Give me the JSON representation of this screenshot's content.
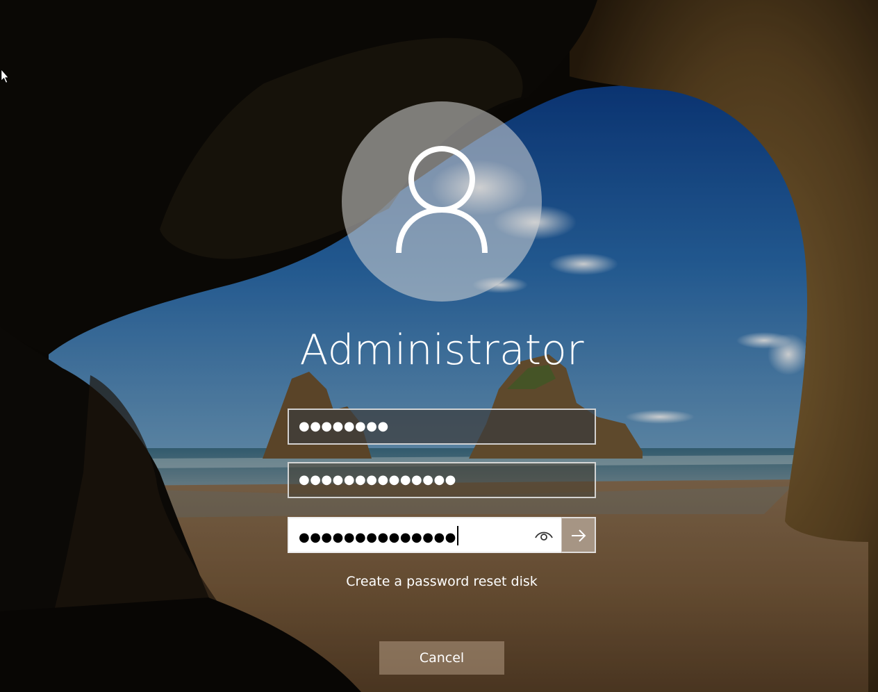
{
  "login": {
    "username": "Administrator",
    "fields": [
      {
        "name": "old-password",
        "masked_value": "●●●●●●●●"
      },
      {
        "name": "new-password",
        "masked_value": "●●●●●●●●●●●●●●"
      },
      {
        "name": "confirm-password",
        "masked_value": "●●●●●●●●●●●●●●"
      }
    ],
    "reset_link": "Create a password reset disk",
    "cancel_label": "Cancel"
  },
  "icons": {
    "avatar": "user-avatar-icon",
    "reveal": "eye-icon",
    "submit": "arrow-right-icon",
    "cursor": "mouse-cursor-icon"
  },
  "colors": {
    "text": "#ffffff",
    "active_field_bg": "#ffffff",
    "submit_bg": "#96826e"
  }
}
